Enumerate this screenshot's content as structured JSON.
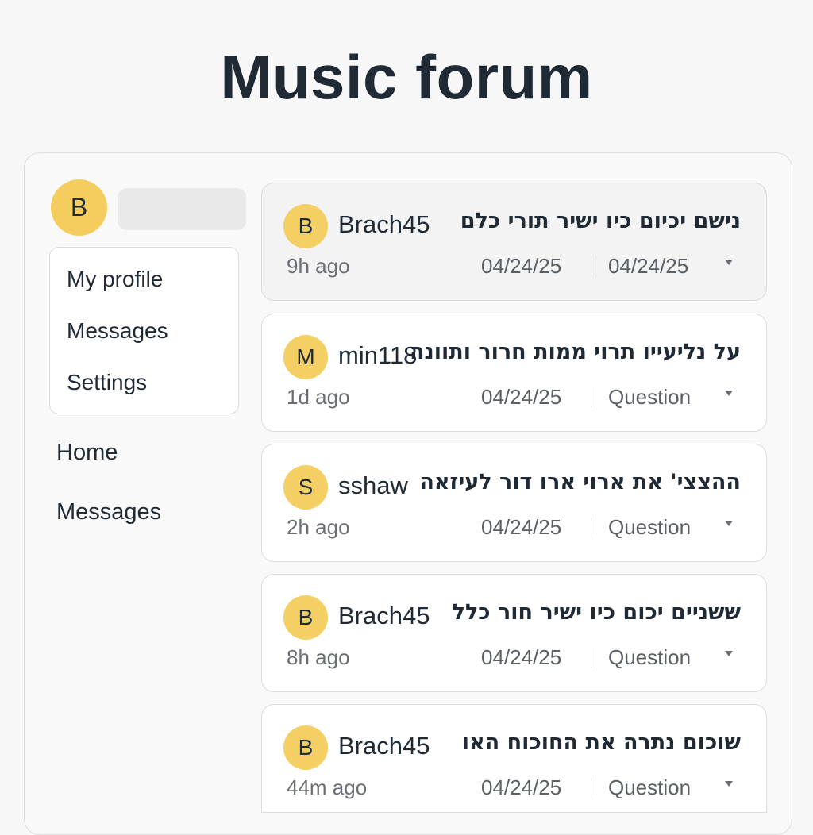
{
  "header": {
    "title": "Music forum"
  },
  "user": {
    "avatar_letter": "B"
  },
  "profile_menu": {
    "items": [
      {
        "label": "My profile"
      },
      {
        "label": "Messages"
      },
      {
        "label": "Settings"
      }
    ]
  },
  "nav": {
    "items": [
      {
        "label": "Home"
      },
      {
        "label": "Messages"
      }
    ]
  },
  "posts": [
    {
      "avatar_letter": "B",
      "author": "Brach45",
      "title": "נישם יכיום כיו ישיר תורי כלם",
      "time": "9h ago",
      "date": "04/24/25",
      "tag": "04/24/25"
    },
    {
      "avatar_letter": "M",
      "author": "min118",
      "title": "על נליעייו תרוי ממות חרור ותוונה",
      "time": "1d ago",
      "date": "04/24/25",
      "tag": "Question"
    },
    {
      "avatar_letter": "S",
      "author": "sshaw",
      "title": "ההצצי' את ארוי ארו דור לעיזאה",
      "time": "2h ago",
      "date": "04/24/25",
      "tag": "Question"
    },
    {
      "avatar_letter": "B",
      "author": "Brach45",
      "title": "ששניים יכום כיו ישיר חור כלל",
      "time": "8h ago",
      "date": "04/24/25",
      "tag": "Question"
    },
    {
      "avatar_letter": "B",
      "author": "Brach45",
      "title": "שוכום נתרה את החוכוח האו",
      "time": "44m ago",
      "date": "04/24/25",
      "tag": "Question"
    }
  ],
  "colors": {
    "avatar": "#f3cf64",
    "text": "#1f2a35",
    "muted": "#6b6f75"
  },
  "icons": {
    "dropdown": "caret-down-icon"
  }
}
